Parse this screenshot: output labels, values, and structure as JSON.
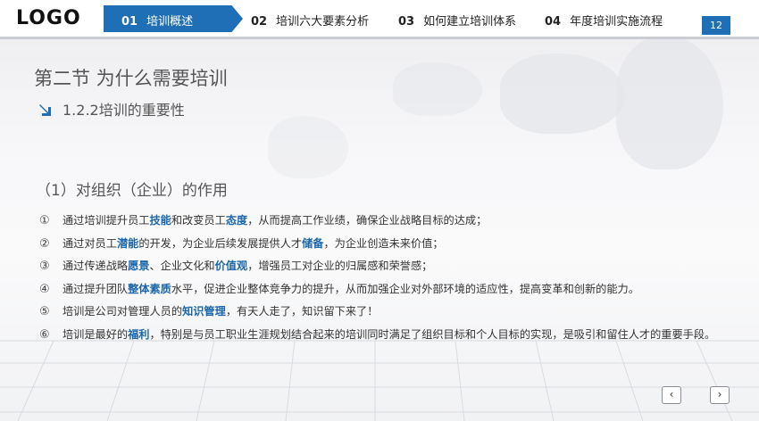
{
  "header": {
    "logo": "LOGO",
    "nav": [
      {
        "num": "01",
        "label": "培训概述",
        "active": true
      },
      {
        "num": "02",
        "label": "培训六大要素分析",
        "active": false
      },
      {
        "num": "03",
        "label": "如何建立培训体系",
        "active": false
      },
      {
        "num": "04",
        "label": "年度培训实施流程",
        "active": false
      }
    ],
    "page_number": "12"
  },
  "content": {
    "section_title": "第二节  为什么需要培训",
    "subtitle": "1.2.2培训的重要性",
    "heading": "（1）对组织（企业）的作用",
    "items": [
      {
        "marker": "①",
        "parts": [
          "通过培训提升员工",
          "技能",
          "和改变员工",
          "态度",
          "，从而提高工作业绩，确保企业战略目标的达成；"
        ]
      },
      {
        "marker": "②",
        "parts": [
          "通过对员工",
          "潜能",
          "的开发，为企业后续发展提供人才",
          "储备",
          "，为企业创造未来价值；"
        ]
      },
      {
        "marker": "③",
        "parts": [
          "通过传递战略",
          "愿景",
          "、企业文化和",
          "价值观",
          "，增强员工对企业的归属感和荣誉感；"
        ]
      },
      {
        "marker": "④",
        "parts": [
          "通过提升团队",
          "整体素质",
          "水平，促进企业整体竞争力的提升，从而加强企业对外部环境的适应性，提高变革和创新的能力。"
        ]
      },
      {
        "marker": "⑤",
        "parts": [
          "培训是公司对管理人员的",
          "知识管理",
          "，有天人走了，知识留下来了！"
        ]
      },
      {
        "marker": "⑥",
        "parts": [
          "培训是最好的",
          "福利",
          "，特别是与员工职业生涯规划结合起来的培训同时满足了组织目标和个人目标的实现，是吸引和留住人才的重要手段。"
        ]
      }
    ]
  },
  "footer": {
    "prev_label": "‹",
    "next_label": "›"
  },
  "colors": {
    "accent": "#1f6fb6",
    "highlight": "#1b66ad"
  }
}
